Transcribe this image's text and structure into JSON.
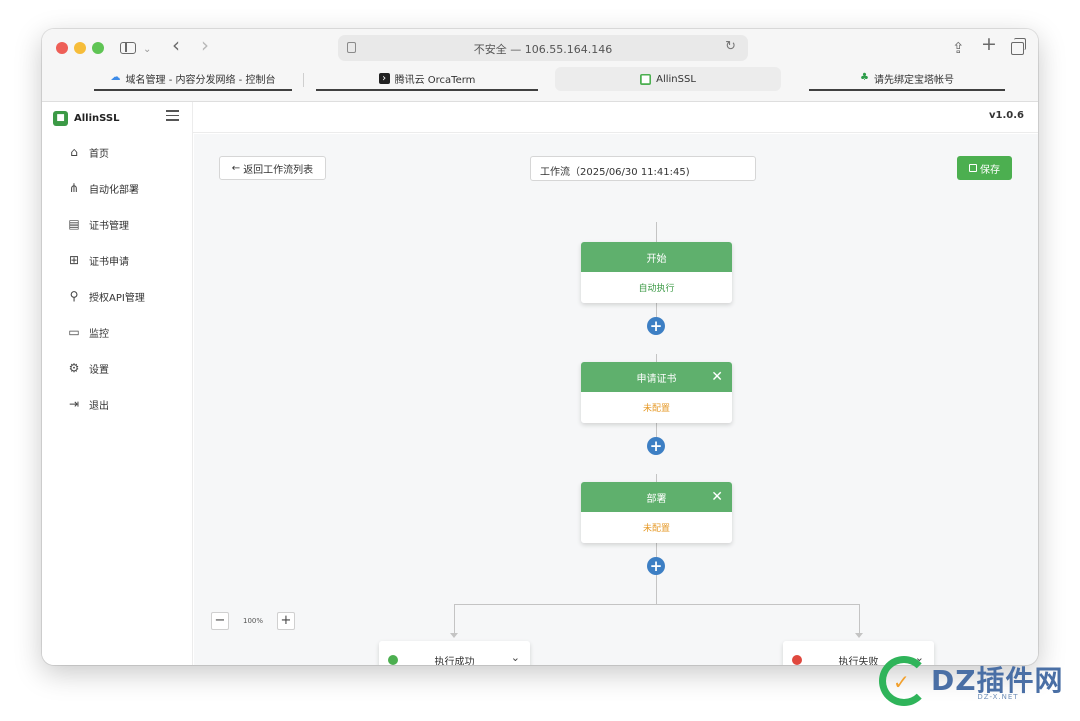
{
  "browser": {
    "address": "不安全 — 106.55.164.146",
    "tabs": [
      {
        "label": "域名管理 - 内容分发网络 - 控制台",
        "icon": "cloud-icon"
      },
      {
        "label": "腾讯云 OrcaTerm",
        "icon": "terminal-icon"
      },
      {
        "label": "AllinSSL",
        "icon": "lock-icon"
      },
      {
        "label": "请先绑定宝塔帐号",
        "icon": "leaf-icon"
      }
    ]
  },
  "app": {
    "brand": "AllinSSL",
    "version": "v1.0.6",
    "nav": [
      {
        "label": "首页",
        "icon": "home-icon"
      },
      {
        "label": "自动化部署",
        "icon": "workflow-icon"
      },
      {
        "label": "证书管理",
        "icon": "certificate-icon"
      },
      {
        "label": "证书申请",
        "icon": "add-square-icon"
      },
      {
        "label": "授权API管理",
        "icon": "api-link-icon"
      },
      {
        "label": "监控",
        "icon": "monitor-icon"
      },
      {
        "label": "设置",
        "icon": "settings-icon"
      },
      {
        "label": "退出",
        "icon": "logout-icon"
      }
    ]
  },
  "toolbar": {
    "back_label": "返回工作流列表",
    "workflow_name": "工作流（2025/06/30 11:41:45)",
    "save_label": "保存"
  },
  "workflow": {
    "nodes": [
      {
        "title": "开始",
        "status": "自动执行"
      },
      {
        "title": "申请证书",
        "status": "未配置"
      },
      {
        "title": "部署",
        "status": "未配置"
      }
    ],
    "branches": [
      {
        "label": "执行成功",
        "color": "#4caf50"
      },
      {
        "label": "执行失败",
        "color": "#e0483e"
      }
    ]
  },
  "zoom": {
    "value": "100%"
  },
  "watermark": {
    "text": "DZ插件网",
    "sub": "DZ-X.NET"
  },
  "colors": {
    "accent": "#4caf50",
    "node_header": "#5fb06d",
    "add_button": "#3d7fc4",
    "warning": "#e69a28"
  }
}
